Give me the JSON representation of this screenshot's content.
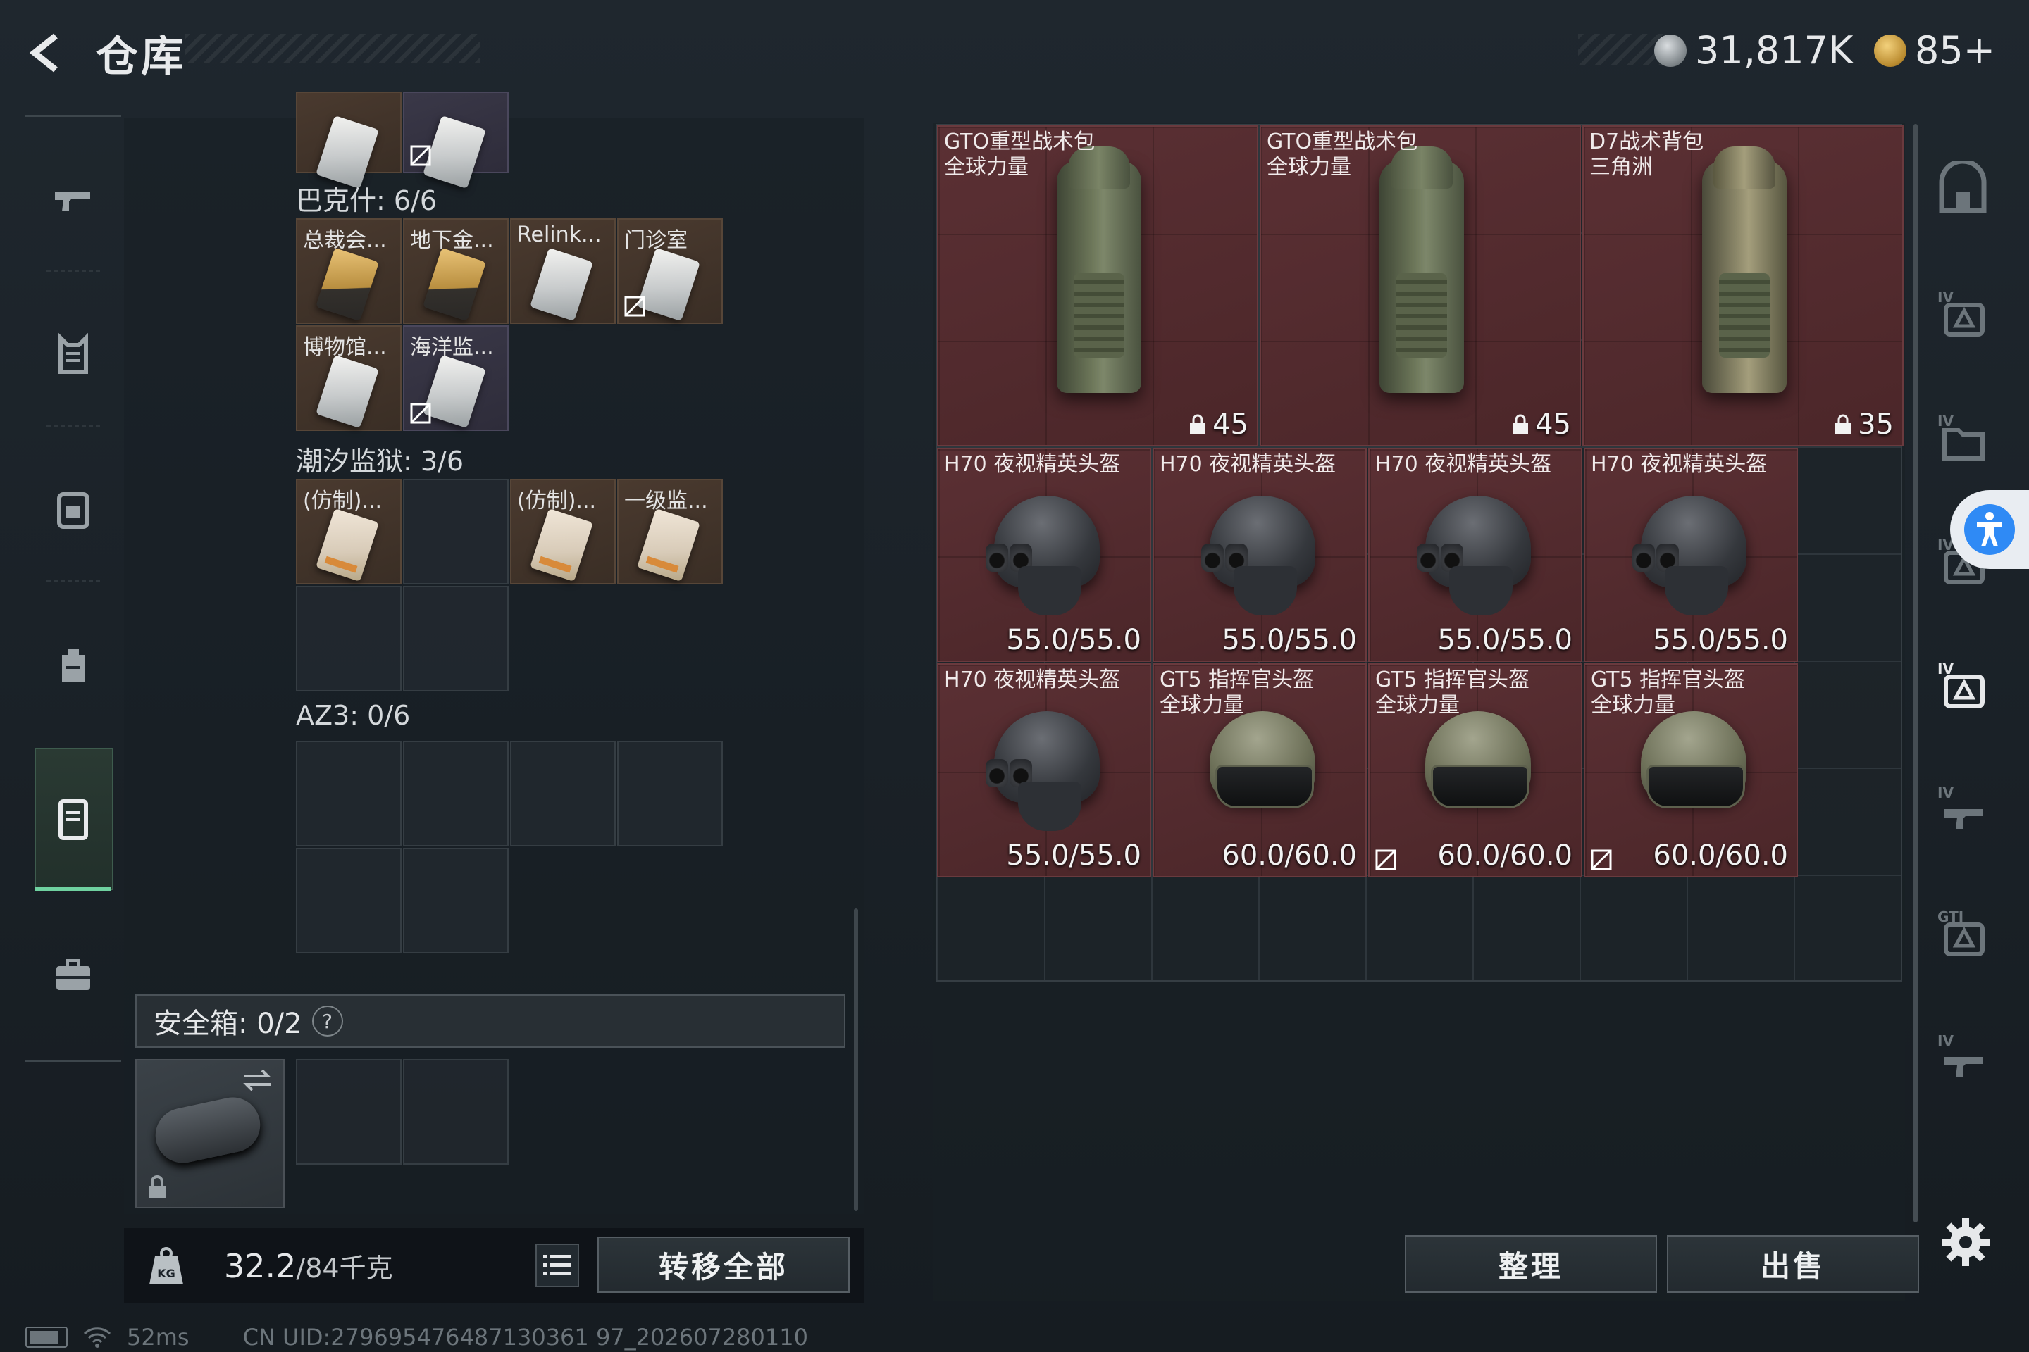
{
  "header": {
    "title": "仓库"
  },
  "currency": [
    {
      "name": "coin-silver",
      "value": "31,817K"
    },
    {
      "name": "coin-gold",
      "value": "85+"
    }
  ],
  "left_nav": [
    "pistol-icon",
    "armor-vest-icon",
    "chest-rig-icon",
    "backpack-icon",
    "safebox-nav-icon",
    "briefcase-icon"
  ],
  "sections": [
    {
      "label": "巴克什: 6/6",
      "cells": [
        {
          "label": "总裁会...",
          "style": "brown",
          "card": "gold"
        },
        {
          "label": "地下金...",
          "style": "brown",
          "card": "gold"
        },
        {
          "label": "Relink...",
          "style": "brown",
          "card": "silver"
        },
        {
          "label": "门诊室",
          "style": "brown",
          "card": "silver",
          "nocross": true
        },
        {
          "label": "博物馆...",
          "style": "brown",
          "card": "silver"
        },
        {
          "label": "海洋监...",
          "style": "purple",
          "card": "silver",
          "nocross": true
        }
      ]
    },
    {
      "label": "潮汐监狱: 3/6",
      "cells": [
        {
          "label": "(仿制)...",
          "style": "brown",
          "card": "copy"
        },
        {
          "label": "(仿制)...",
          "style": "brown",
          "card": "copy"
        },
        {
          "label": "一级监...",
          "style": "brown",
          "card": "copy"
        }
      ]
    },
    {
      "label": "AZ3: 0/6"
    }
  ],
  "safebox": {
    "label": "安全箱: 0/2",
    "help": "?"
  },
  "weight": {
    "current": "32.2",
    "max": "/84千克"
  },
  "buttons": {
    "transfer_all": "转移全部",
    "sort": "整理",
    "sell": "出售"
  },
  "items": [
    {
      "name": "GTO重型战术包\n全球力量",
      "value": "45",
      "type": "backpack",
      "lock": true
    },
    {
      "name": "GTO重型战术包\n全球力量",
      "value": "45",
      "type": "backpack",
      "lock": true
    },
    {
      "name": "D7战术背包\n三角洲",
      "value": "35",
      "type": "backpack-tan",
      "lock": true
    },
    {
      "name": "H70 夜视精英头盔",
      "value": "55.0/55.0",
      "type": "helmet-nvg"
    },
    {
      "name": "H70 夜视精英头盔",
      "value": "55.0/55.0",
      "type": "helmet-nvg"
    },
    {
      "name": "H70 夜视精英头盔",
      "value": "55.0/55.0",
      "type": "helmet-nvg"
    },
    {
      "name": "H70 夜视精英头盔",
      "value": "55.0/55.0",
      "type": "helmet-nvg"
    },
    {
      "name": "H70 夜视精英头盔",
      "value": "55.0/55.0",
      "type": "helmet-nvg"
    },
    {
      "name": "GT5 指挥官头盔\n全球力量",
      "value": "60.0/60.0",
      "type": "helmet-gt5"
    },
    {
      "name": "GT5 指挥官头盔\n全球力量",
      "value": "60.0/60.0",
      "type": "helmet-gt5",
      "nocross": true
    },
    {
      "name": "GT5 指挥官头盔\n全球力量",
      "value": "60.0/60.0",
      "type": "helmet-gt5",
      "nocross": true
    }
  ],
  "right_nav": [
    "storage-home-icon",
    "tier4-container-icon",
    "tier4-folder-icon",
    "tier4-container-icon",
    "tier4-container-active-icon",
    "tier4-gun-icon",
    "gti-container-icon",
    "tier4-gun-icon"
  ],
  "status": {
    "ping": "52ms",
    "uid": "CN UID:279695476487130361 97_202607280110"
  }
}
